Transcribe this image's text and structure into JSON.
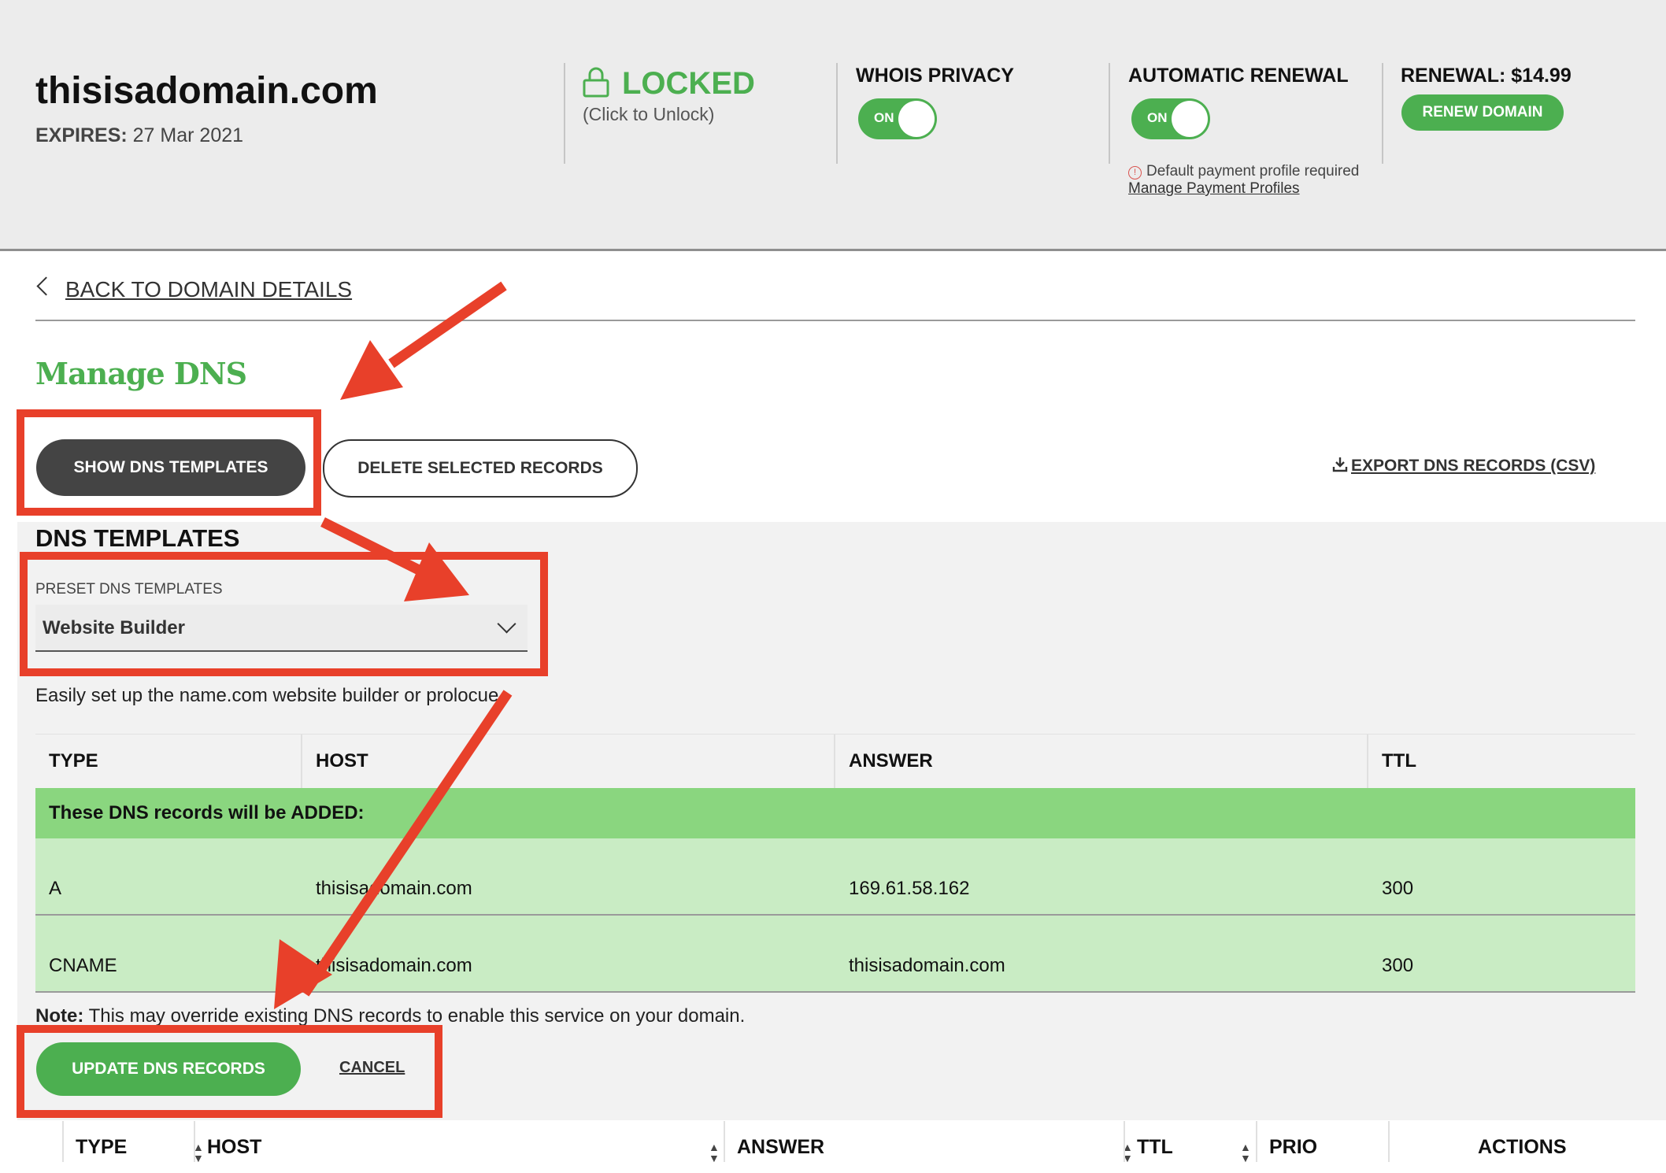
{
  "header": {
    "domain": "thisisadomain.com",
    "expires_label": "EXPIRES:",
    "expires_value": "27 Mar 2021",
    "lock": {
      "status": "LOCKED",
      "hint": "(Click to Unlock)"
    },
    "whois": {
      "title": "WHOIS PRIVACY",
      "toggle": "ON"
    },
    "auto_renewal": {
      "title": "AUTOMATIC RENEWAL",
      "toggle": "ON",
      "note": "Default payment profile required",
      "link": "Manage Payment Profiles"
    },
    "renewal": {
      "price_label": "RENEWAL: $14.99",
      "button": "RENEW DOMAIN"
    }
  },
  "nav": {
    "back": "BACK TO DOMAIN DETAILS"
  },
  "page_title": "Manage DNS",
  "toolbar": {
    "show_templates": "SHOW DNS TEMPLATES",
    "delete_selected": "DELETE SELECTED RECORDS",
    "export": "EXPORT DNS RECORDS (CSV)"
  },
  "templates": {
    "title": "DNS TEMPLATES",
    "preset_label": "PRESET DNS TEMPLATES",
    "selected": "Website Builder",
    "description": "Easily set up the name.com website builder or prolocue",
    "columns": [
      "TYPE",
      "HOST",
      "ANSWER",
      "TTL"
    ],
    "added_banner": "These DNS records will be ADDED:",
    "records": [
      {
        "type": "A",
        "host": "thisisadomain.com",
        "answer": "169.61.58.162",
        "ttl": "300"
      },
      {
        "type": "CNAME",
        "host": "thisisadomain.com",
        "answer": "thisisadomain.com",
        "ttl": "300"
      }
    ],
    "note_label": "Note:",
    "note_text": "This may override existing DNS records to enable this service on your domain.",
    "update_button": "UPDATE DNS RECORDS",
    "cancel": "CANCEL"
  },
  "records_table": {
    "columns": [
      "TYPE",
      "HOST",
      "ANSWER",
      "TTL",
      "PRIO",
      "ACTIONS"
    ]
  },
  "colors": {
    "brand_green": "#4caf50",
    "annotation_red": "#e8402a",
    "added_banner": "#8ad67f",
    "added_row": "#c9ecc4"
  },
  "icons": [
    "lock-icon",
    "chevron-left-icon",
    "download-icon",
    "chevron-down-icon",
    "warning-icon",
    "sort-icon"
  ]
}
